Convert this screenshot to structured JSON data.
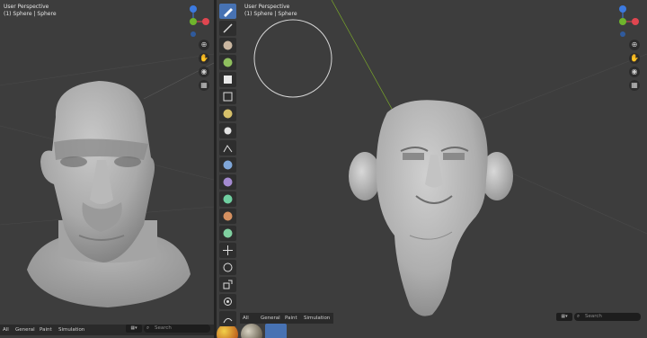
{
  "left_viewport": {
    "view_label": "User Perspective",
    "object_label": "(1) Sphere | Sphere"
  },
  "right_viewport": {
    "view_label": "User Perspective",
    "object_label": "(1) Sphere | Sphere"
  },
  "gizmo": {
    "z_axis": "Z",
    "y_axis": "Y",
    "x_axis": "X",
    "colors": {
      "x": "#e04650",
      "y": "#6fb42c",
      "z": "#3c7ae0"
    }
  },
  "nav_icons": [
    "zoom-icon",
    "hand-pan-icon",
    "camera-icon",
    "grid-ortho-icon"
  ],
  "toolbar_tools": [
    "draw-brush-tool",
    "draw-sharp-tool",
    "clay-tool",
    "clay-strips-tool",
    "clay-thumb-tool",
    "layer-tool",
    "inflate-tool",
    "blob-tool",
    "crease-tool",
    "smooth-tool",
    "flatten-tool",
    "fill-tool",
    "scrape-tool",
    "multiplane-scrape-tool",
    "move-tool",
    "rotate-tool",
    "scale-tool",
    "transform-tool",
    "annotate-tool"
  ],
  "left_bottom_bar": {
    "tabs": [
      "All",
      "General",
      "Paint",
      "Simulation"
    ],
    "active_tab": "General",
    "search_placeholder": "Search"
  },
  "right_bottom_bar": {
    "tabs": [
      "All",
      "General",
      "Paint",
      "Simulation"
    ],
    "active_tab": "General",
    "search_placeholder": "Search"
  },
  "brush_cursor": "brush-radius-circle"
}
